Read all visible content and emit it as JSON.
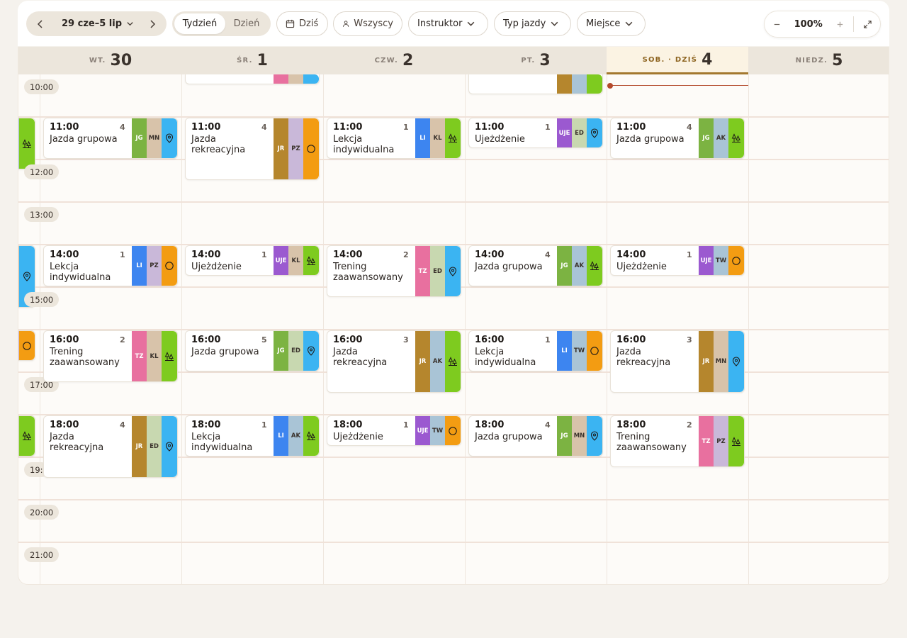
{
  "toolbar": {
    "date_range": "29 cze–5 lip",
    "view_week": "Tydzień",
    "view_day": "Dzień",
    "today": "Dziś",
    "all": "Wszyscy",
    "instructor": "Instruktor",
    "ride_type": "Typ jazdy",
    "place": "Miejsce",
    "zoom": "100%"
  },
  "days": [
    {
      "name": "WT.",
      "num": "30"
    },
    {
      "name": "ŚR.",
      "num": "1"
    },
    {
      "name": "CZW.",
      "num": "2"
    },
    {
      "name": "PT.",
      "num": "3"
    },
    {
      "name": "SOB. · DZIŚ",
      "num": "4"
    },
    {
      "name": "NIEDZ.",
      "num": "5"
    }
  ],
  "times": [
    "10:00",
    "12:00",
    "13:00",
    "15:00",
    "17:00",
    "19:",
    "20:00",
    "21:00"
  ],
  "events": [
    {
      "time": "11:00",
      "count": "4",
      "title": "Jazda grupowa",
      "tags": [
        "JG",
        "MN"
      ]
    },
    {
      "time": "11:00",
      "count": "4",
      "title": "Jazda rekreacyjna",
      "tags": [
        "JR",
        "PZ"
      ]
    },
    {
      "time": "11:00",
      "count": "1",
      "title": "Lekcja indywidualna",
      "tags": [
        "LI",
        "KL"
      ]
    },
    {
      "time": "11:00",
      "count": "1",
      "title": "Ujeżdżenie",
      "tags": [
        "UJE",
        "ED"
      ]
    },
    {
      "time": "11:00",
      "count": "4",
      "title": "Jazda grupowa",
      "tags": [
        "JG",
        "AK"
      ]
    },
    {
      "time": "14:00",
      "count": "1",
      "title": "Lekcja indywidualna",
      "tags": [
        "LI",
        "PZ"
      ]
    },
    {
      "time": "14:00",
      "count": "1",
      "title": "Ujeżdżenie",
      "tags": [
        "UJE",
        "KL"
      ]
    },
    {
      "time": "14:00",
      "count": "2",
      "title": "Trening zaawansowany",
      "tags": [
        "TZ",
        "ED"
      ]
    },
    {
      "time": "14:00",
      "count": "4",
      "title": "Jazda grupowa",
      "tags": [
        "JG",
        "AK"
      ]
    },
    {
      "time": "14:00",
      "count": "1",
      "title": "Ujeżdżenie",
      "tags": [
        "UJE",
        "TW"
      ]
    },
    {
      "time": "16:00",
      "count": "2",
      "title": "Trening zaawansowany",
      "tags": [
        "TZ",
        "KL"
      ]
    },
    {
      "time": "16:00",
      "count": "5",
      "title": "Jazda grupowa",
      "tags": [
        "JG",
        "ED"
      ]
    },
    {
      "time": "16:00",
      "count": "3",
      "title": "Jazda rekreacyjna",
      "tags": [
        "JR",
        "AK"
      ]
    },
    {
      "time": "16:00",
      "count": "1",
      "title": "Lekcja indywidualna",
      "tags": [
        "LI",
        "TW"
      ]
    },
    {
      "time": "16:00",
      "count": "3",
      "title": "Jazda rekreacyjna",
      "tags": [
        "JR",
        "MN"
      ]
    },
    {
      "time": "18:00",
      "count": "4",
      "title": "Jazda rekreacyjna",
      "tags": [
        "JR",
        "ED"
      ]
    },
    {
      "time": "18:00",
      "count": "1",
      "title": "Lekcja indywidualna",
      "tags": [
        "LI",
        "AK"
      ]
    },
    {
      "time": "18:00",
      "count": "1",
      "title": "Ujeżdżenie",
      "tags": [
        "UJE",
        "TW"
      ]
    },
    {
      "time": "18:00",
      "count": "4",
      "title": "Jazda grupowa",
      "tags": [
        "JG",
        "MN"
      ]
    },
    {
      "time": "18:00",
      "count": "2",
      "title": "Trening zaawansowany",
      "tags": [
        "TZ",
        "PZ"
      ]
    }
  ],
  "colors": {
    "JG": "#7cb342",
    "JR": "#b5862d",
    "LI": "#3d85f0",
    "UJE": "#9b59d0",
    "TZ": "#e8709f",
    "MN": "#d8c3aa",
    "PZ": "#c9b8d9",
    "KL": "#d8c3aa",
    "ED": "#c8d8b0",
    "AK": "#a9c4d6",
    "TW": "#a9c4d6",
    "place_green": "#7ecb1f",
    "place_blue": "#3bb4f2",
    "place_orange": "#f39c12",
    "accent": "#a3782f",
    "now": "#b44a2c"
  }
}
